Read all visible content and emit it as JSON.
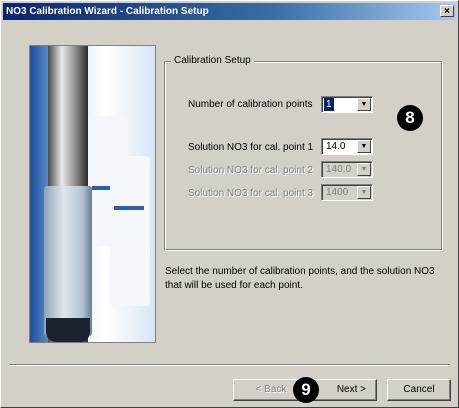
{
  "window": {
    "title": "NO3 Calibration Wizard - Calibration Setup",
    "close_glyph": "×"
  },
  "group": {
    "caption": "Calibration Setup"
  },
  "fields": {
    "num_points_label": "Number of calibration points",
    "num_points_value": "1",
    "point1_label": "Solution NO3 for cal. point 1",
    "point1_value": "14.0",
    "point2_label": "Solution NO3 for cal. point 2",
    "point2_value": "140.0",
    "point3_label": "Solution NO3 for cal. point 3",
    "point3_value": "1400"
  },
  "help_text": "Select the number of calibration points, and the solution NO3 that will be used for each point.",
  "badges": {
    "step8": "8",
    "step9": "9"
  },
  "buttons": {
    "back": "< Back",
    "next": "Next >",
    "cancel": "Cancel"
  },
  "icons": {
    "dropdown": "chevron-down-icon",
    "close": "close-icon"
  }
}
